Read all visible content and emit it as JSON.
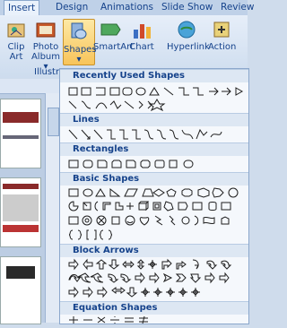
{
  "tabs": [
    "Insert",
    "Design",
    "Animations",
    "Slide Show",
    "Review"
  ],
  "ribbon": {
    "buttons": [
      {
        "label1": "Clip",
        "label2": "Art"
      },
      {
        "label1": "Photo",
        "label2": "Album ▾"
      },
      {
        "label1": "Shapes",
        "label2": ""
      },
      {
        "label1": "SmartArt",
        "label2": ""
      },
      {
        "label1": "Chart",
        "label2": ""
      },
      {
        "label1": "Hyperlink",
        "label2": ""
      },
      {
        "label1": "Action",
        "label2": ""
      }
    ],
    "group_label": "Illustr"
  },
  "menu": {
    "sections": [
      "Recently Used Shapes",
      "Lines",
      "Rectangles",
      "Basic Shapes",
      "Block Arrows",
      "Equation Shapes"
    ]
  },
  "colors": {
    "accent": "#f8c45a",
    "brand": "#15428b"
  }
}
